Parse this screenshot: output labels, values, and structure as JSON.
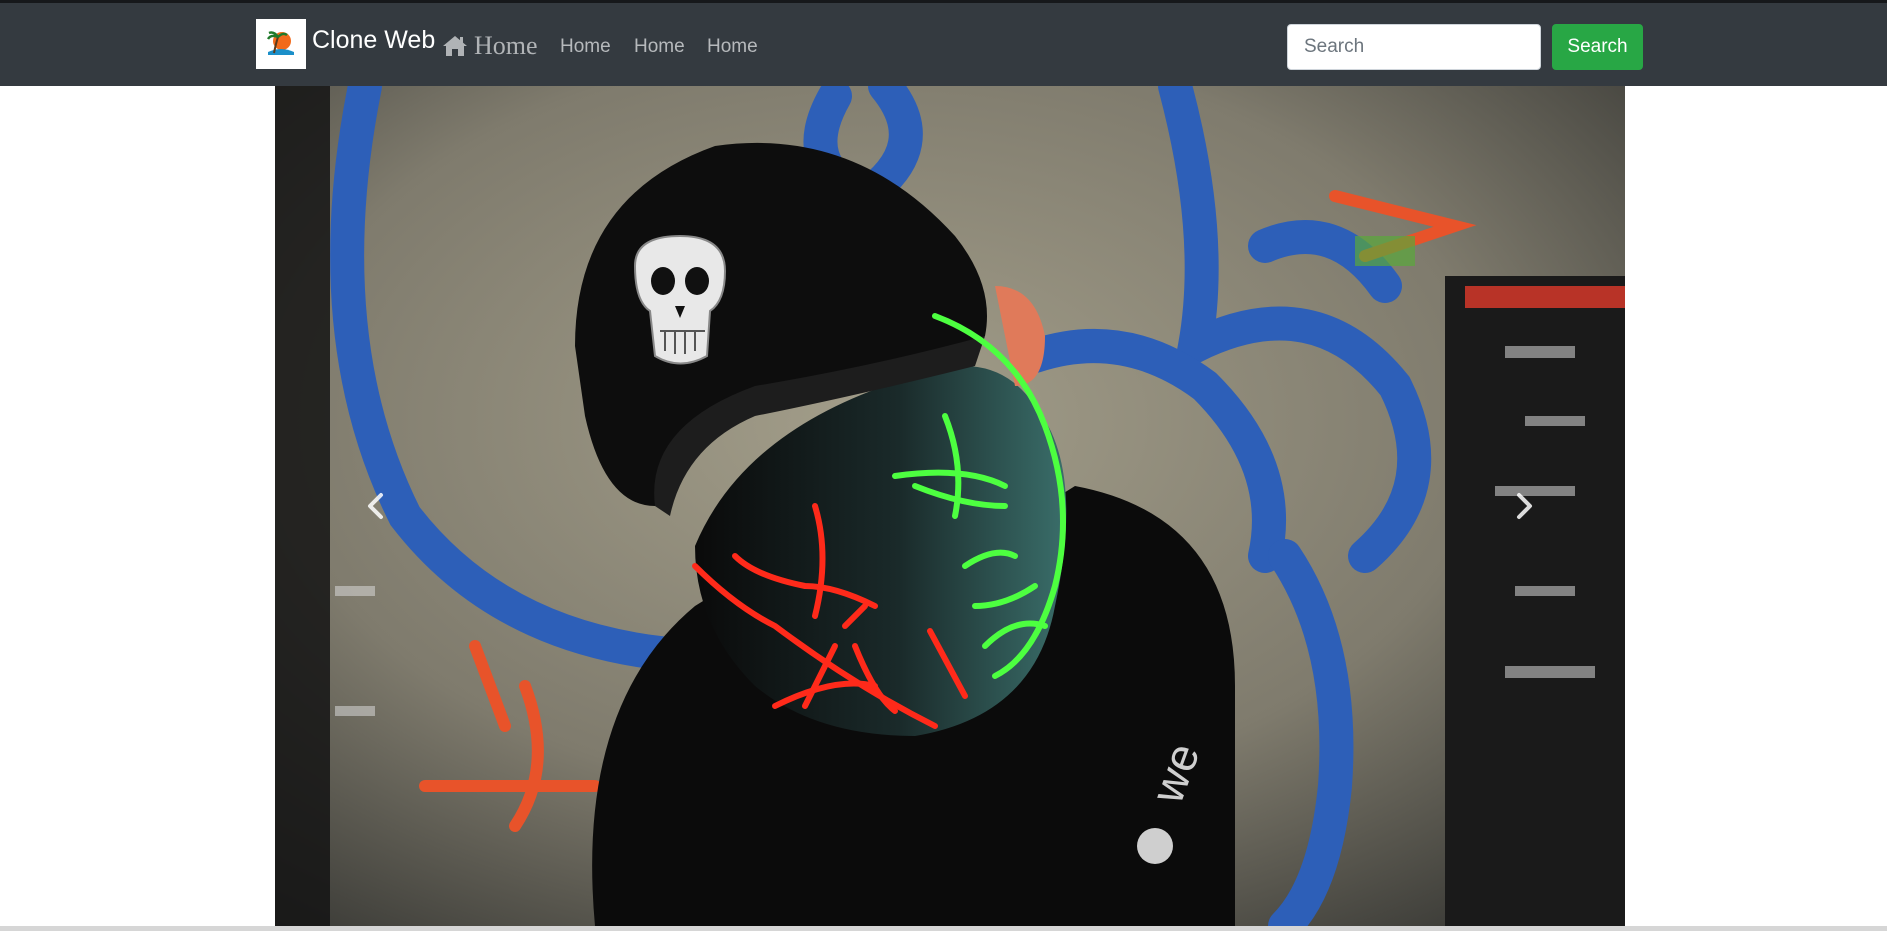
{
  "brand": {
    "name": "Clone Web",
    "logo": "island-sunset-logo"
  },
  "nav": {
    "home_main": "Home",
    "home_icon": "home-icon",
    "links": [
      "Home",
      "Home",
      "Home"
    ]
  },
  "search": {
    "placeholder": "Search",
    "button_label": "Search"
  },
  "carousel": {
    "image": "masked-person-led-purge-mask-graffiti-wall",
    "prev_icon": "chevron-left-icon",
    "next_icon": "chevron-right-icon"
  },
  "colors": {
    "navbar": "#343a40",
    "search_button": "#28a745",
    "accent_red": "#ff2a1a",
    "accent_green": "#4dff40"
  }
}
